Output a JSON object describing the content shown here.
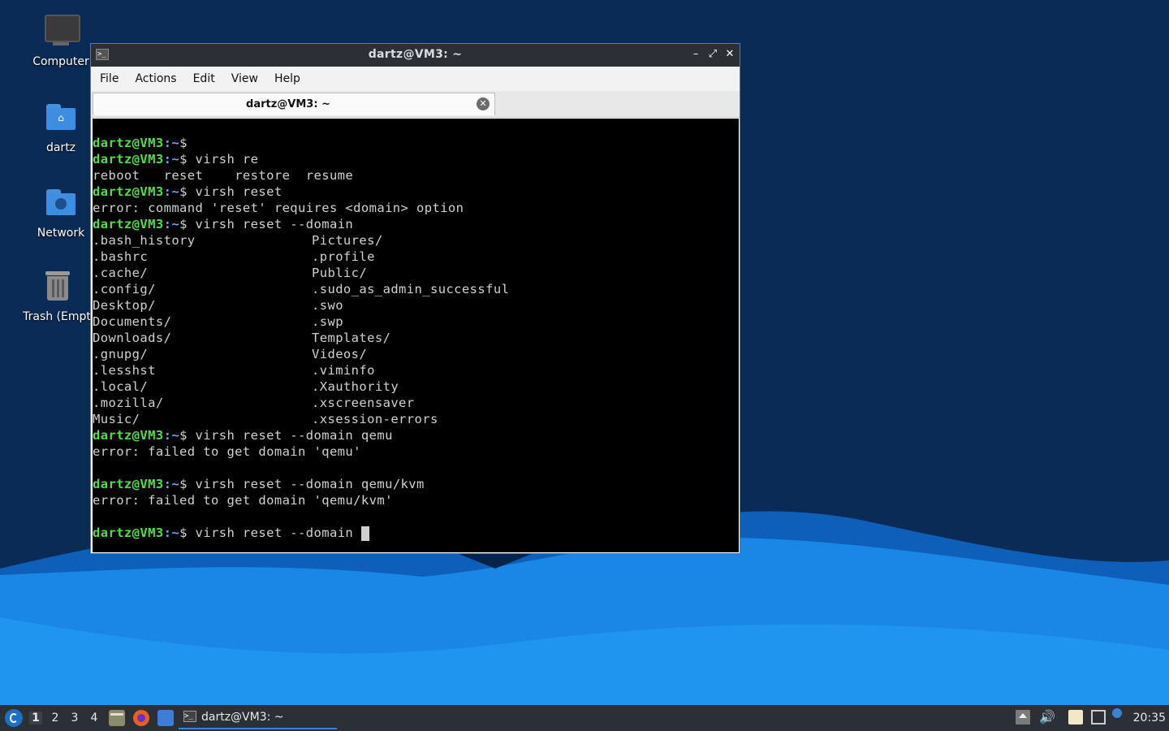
{
  "colors": {
    "prompt_user": "#4ee046",
    "prompt_path": "#6aa0ff",
    "terminal_bg": "#000000",
    "taskbar_bg": "#2b3036",
    "window_border": "#3b82d6"
  },
  "desktop": {
    "icons": [
      {
        "label": "Computer",
        "icon": "computer-icon"
      },
      {
        "label": "dartz",
        "icon": "home-folder-icon"
      },
      {
        "label": "Network",
        "icon": "network-folder-icon"
      },
      {
        "label": "Trash (Empt",
        "icon": "trash-icon"
      }
    ]
  },
  "window": {
    "title": "dartz@VM3: ~",
    "controls": {
      "minimize": "–",
      "maximize": "⤢",
      "close": "✕"
    },
    "menu": [
      "File",
      "Actions",
      "Edit",
      "View",
      "Help"
    ],
    "tab": {
      "label": "dartz@VM3: ~",
      "close": "✕"
    }
  },
  "terminal": {
    "prompt_user": "dartz@VM3",
    "prompt_path": ":~",
    "prompt_symbol": "$",
    "lines": [
      {
        "type": "prompt",
        "cmd": ""
      },
      {
        "type": "prompt",
        "cmd": " virsh re"
      },
      {
        "type": "out",
        "text": "reboot   reset    restore  resume"
      },
      {
        "type": "prompt",
        "cmd": " virsh reset"
      },
      {
        "type": "out",
        "text": "error: command 'reset' requires <domain> option"
      },
      {
        "type": "prompt",
        "cmd": " virsh reset --domain"
      },
      {
        "type": "cols",
        "a": ".bash_history",
        "b": "Pictures/"
      },
      {
        "type": "cols",
        "a": ".bashrc",
        "b": ".profile"
      },
      {
        "type": "cols",
        "a": ".cache/",
        "b": "Public/"
      },
      {
        "type": "cols",
        "a": ".config/",
        "b": ".sudo_as_admin_successful"
      },
      {
        "type": "cols",
        "a": "Desktop/",
        "b": ".swo"
      },
      {
        "type": "cols",
        "a": "Documents/",
        "b": ".swp"
      },
      {
        "type": "cols",
        "a": "Downloads/",
        "b": "Templates/"
      },
      {
        "type": "cols",
        "a": ".gnupg/",
        "b": "Videos/"
      },
      {
        "type": "cols",
        "a": ".lesshst",
        "b": ".viminfo"
      },
      {
        "type": "cols",
        "a": ".local/",
        "b": ".Xauthority"
      },
      {
        "type": "cols",
        "a": ".mozilla/",
        "b": ".xscreensaver"
      },
      {
        "type": "cols",
        "a": "Music/",
        "b": ".xsession-errors"
      },
      {
        "type": "prompt",
        "cmd": " virsh reset --domain qemu"
      },
      {
        "type": "out",
        "text": "error: failed to get domain 'qemu'"
      },
      {
        "type": "out",
        "text": ""
      },
      {
        "type": "prompt",
        "cmd": " virsh reset --domain qemu/kvm"
      },
      {
        "type": "out",
        "text": "error: failed to get domain 'qemu/kvm'"
      },
      {
        "type": "out",
        "text": ""
      },
      {
        "type": "prompt",
        "cmd": " virsh reset --domain ",
        "cursor": true
      }
    ]
  },
  "taskbar": {
    "workspaces": [
      "1",
      "2",
      "3",
      "4"
    ],
    "active_workspace": "1",
    "launchers": [
      "file-manager-icon",
      "firefox-icon",
      "show-desktop-icon"
    ],
    "task": {
      "label": "dartz@VM3: ~"
    },
    "tray": [
      "eject-icon",
      "volume-icon",
      "clipboard-icon",
      "network-tray-icon",
      "update-notifier-icon"
    ],
    "clock": "20:35"
  }
}
